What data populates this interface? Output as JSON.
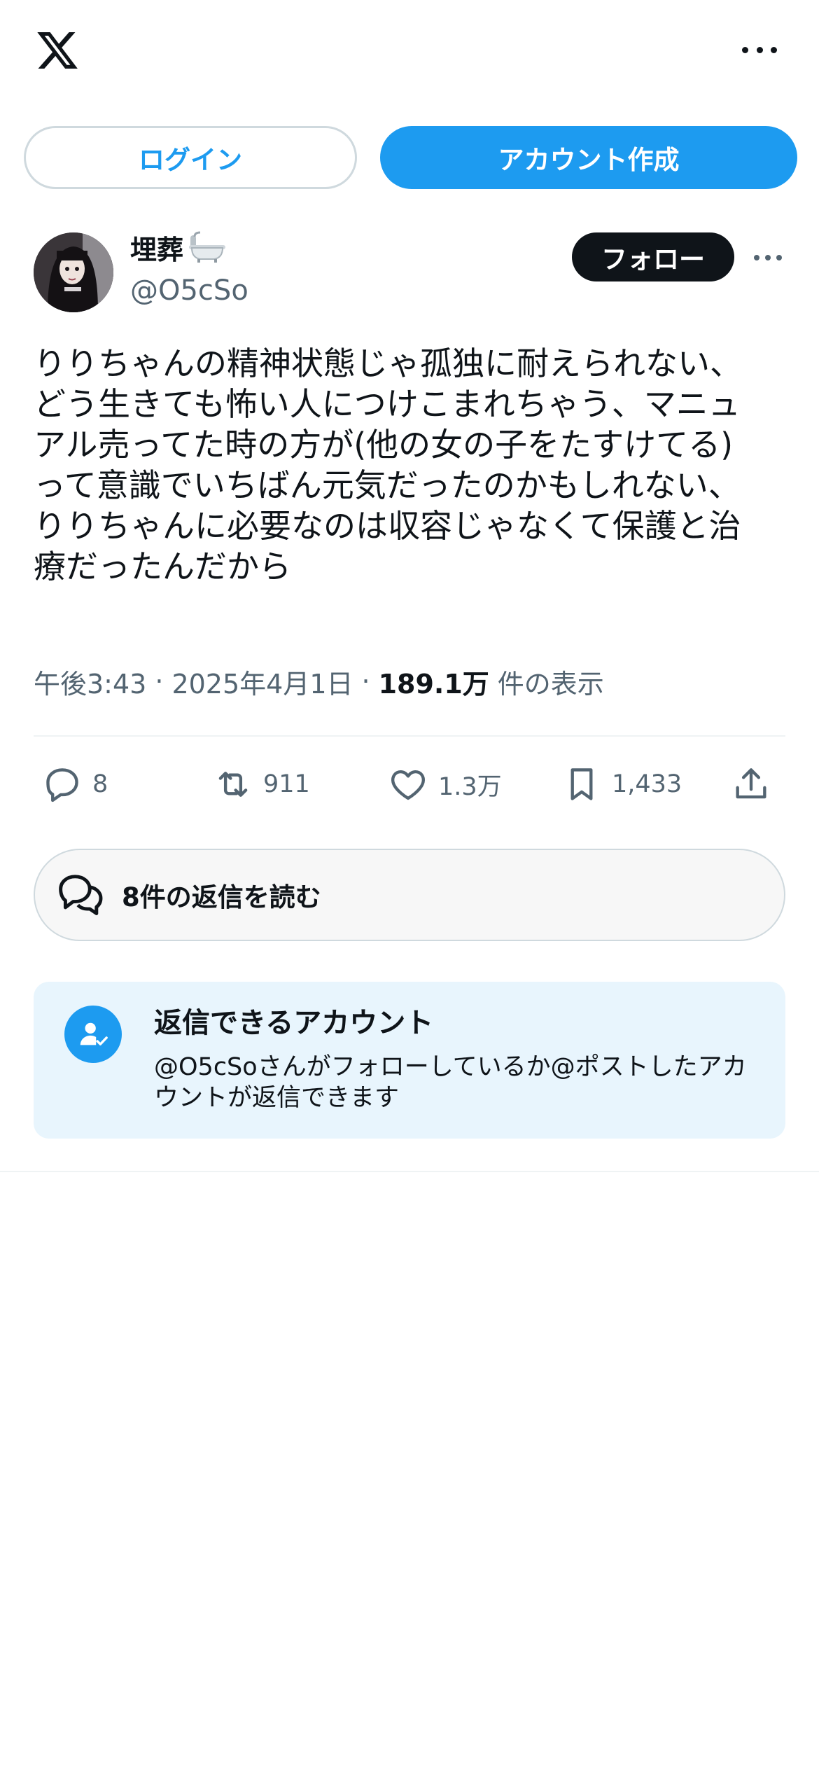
{
  "header": {
    "logo_icon": "x-logo-icon",
    "more_icon": "more-horizontal-icon"
  },
  "auth": {
    "login_label": "ログイン",
    "signup_label": "アカウント作成"
  },
  "author": {
    "display_name": "埋葬",
    "name_emoji_icon": "bathtub-icon",
    "handle": "@O5cSo",
    "follow_label": "フォロー"
  },
  "post": {
    "text": "りりちゃんの精神状態じゃ孤独に耐えられない、\nどう生きても怖い人につけこまれちゃう、マニュ\nアル売ってた時の方が(他の女の子をたすけてる)\nって意識でいちばん元気だったのかもしれない、\nりりちゃんに必要なのは収容じゃなくて保護と治\n療だったんだから",
    "time": "午後3:43",
    "separator": "·",
    "date": "2025年4月1日",
    "views_count": "189.1万",
    "views_label": "件の表示"
  },
  "actions": {
    "replies": "8",
    "reposts": "911",
    "likes": "1.3万",
    "bookmarks": "1,433"
  },
  "replies_button": {
    "label": "8件の返信を読む"
  },
  "reply_info": {
    "title": "返信できるアカウント",
    "description": "@O5cSoさんがフォローしているか@ポストしたアカウントが返信できます"
  },
  "colors": {
    "accent": "#1d9bf0",
    "text_primary": "#0f1419",
    "text_secondary": "#536471",
    "reply_box_bg": "#e8f5fd"
  }
}
